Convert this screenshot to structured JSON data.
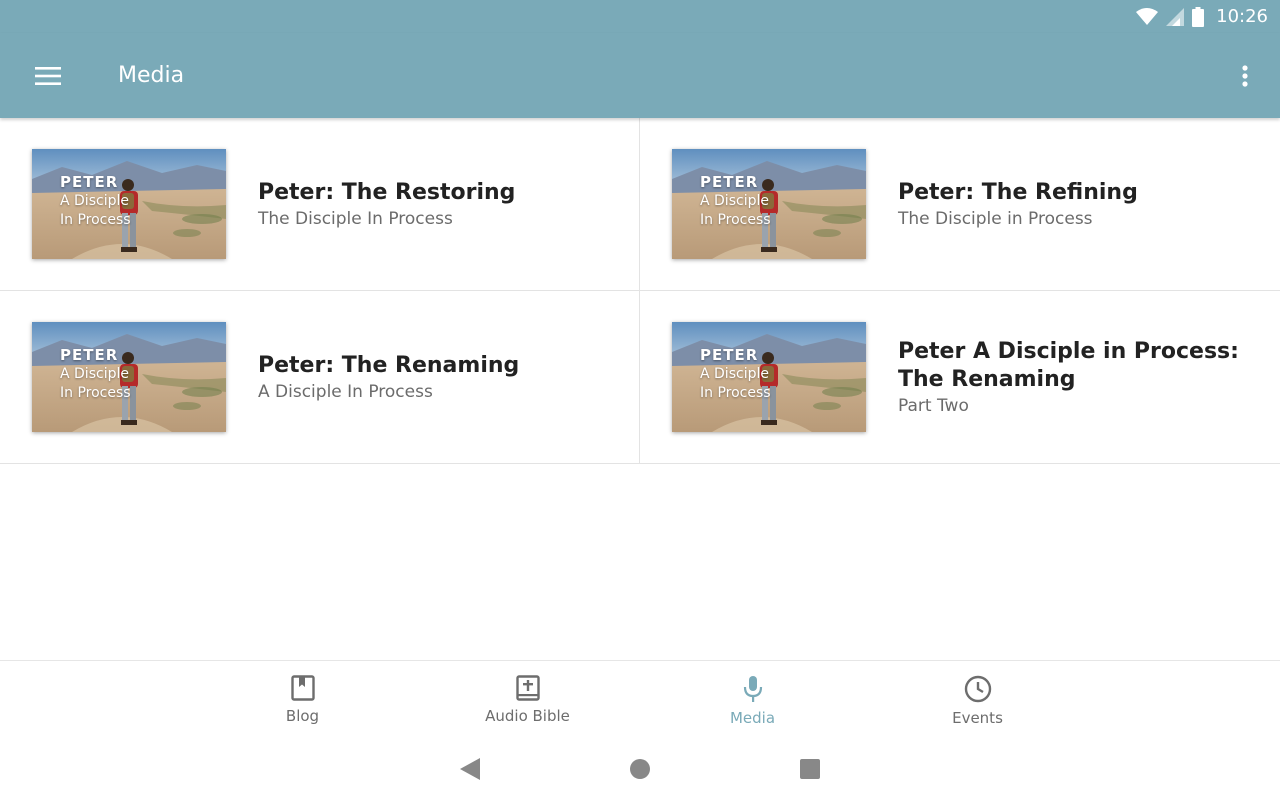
{
  "status_bar": {
    "time": "10:26"
  },
  "app_bar": {
    "title": "Media"
  },
  "items": [
    {
      "title": "Peter: The Restoring",
      "subtitle": "The Disciple In Process",
      "thumb": {
        "line1": "PETER",
        "line2": "A Disciple",
        "line3": "In Process"
      }
    },
    {
      "title": "Peter: The Refining",
      "subtitle": "The Disciple in Process",
      "thumb": {
        "line1": "PETER",
        "line2": "A Disciple",
        "line3": "In Process"
      }
    },
    {
      "title": "Peter: The Renaming",
      "subtitle": "A Disciple In Process",
      "thumb": {
        "line1": "PETER",
        "line2": "A Disciple",
        "line3": "In Process"
      }
    },
    {
      "title": "Peter  A Disciple in Process: The Renaming",
      "subtitle": "Part Two",
      "thumb": {
        "line1": "PETER",
        "line2": "A Disciple",
        "line3": "In Process"
      }
    }
  ],
  "bottom_nav": [
    {
      "label": "Blog",
      "icon": "bookmark-book-icon"
    },
    {
      "label": "Audio Bible",
      "icon": "bible-icon"
    },
    {
      "label": "Media",
      "icon": "microphone-icon",
      "active": true
    },
    {
      "label": "Events",
      "icon": "clock-icon"
    }
  ],
  "colors": {
    "accent": "#7aaab8",
    "title_text": "#222222",
    "subtitle_text": "#6b6b6b"
  }
}
